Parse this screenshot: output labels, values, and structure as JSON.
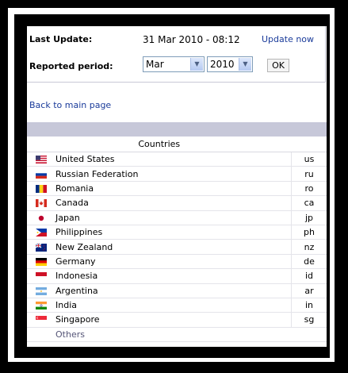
{
  "header": {
    "last_update_label": "Last Update:",
    "last_update_value": "31 Mar 2010 - 08:12",
    "update_now_label": "Update now",
    "reported_period_label": "Reported period:",
    "month_selected": "Mar",
    "year_selected": "2010",
    "ok_label": "OK"
  },
  "nav": {
    "back_label": "Back to main page"
  },
  "table": {
    "column_header": "Countries",
    "rows": [
      {
        "name": "United States",
        "code": "us",
        "flag": "us-flag-icon"
      },
      {
        "name": "Russian Federation",
        "code": "ru",
        "flag": "ru-flag-icon"
      },
      {
        "name": "Romania",
        "code": "ro",
        "flag": "ro-flag-icon"
      },
      {
        "name": "Canada",
        "code": "ca",
        "flag": "ca-flag-icon"
      },
      {
        "name": "Japan",
        "code": "jp",
        "flag": "jp-flag-icon"
      },
      {
        "name": "Philippines",
        "code": "ph",
        "flag": "ph-flag-icon"
      },
      {
        "name": "New Zealand",
        "code": "nz",
        "flag": "nz-flag-icon"
      },
      {
        "name": "Germany",
        "code": "de",
        "flag": "de-flag-icon"
      },
      {
        "name": "Indonesia",
        "code": "id",
        "flag": "id-flag-icon"
      },
      {
        "name": "Argentina",
        "code": "ar",
        "flag": "ar-flag-icon"
      },
      {
        "name": "India",
        "code": "in",
        "flag": "in-flag-icon"
      },
      {
        "name": "Singapore",
        "code": "sg",
        "flag": "sg-flag-icon"
      }
    ],
    "others_label": "Others"
  },
  "colors": {
    "link": "#1a3b9a",
    "band": "#c7c8d9",
    "frame": "#000000"
  }
}
